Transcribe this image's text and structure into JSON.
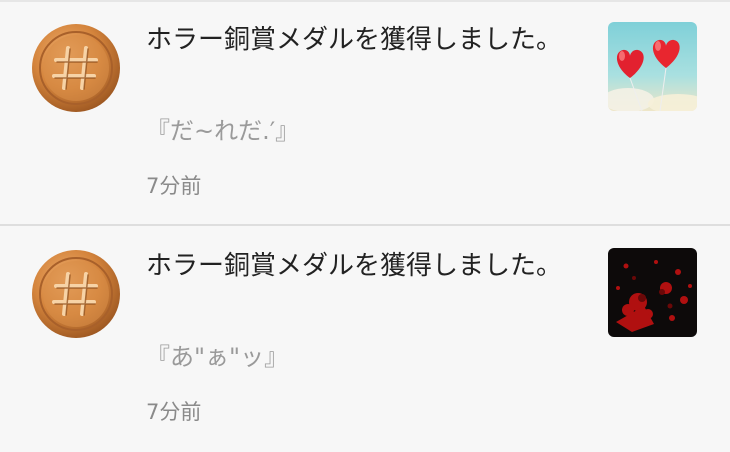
{
  "notifications": [
    {
      "message": "ホラー銅賞メダルを獲得しました。",
      "story_title": "『だ~れだ.′』",
      "time": "7分前",
      "medal_icon": "bronze-hash-medal-icon",
      "thumbnail": "red-heart-balloons-thumbnail"
    },
    {
      "message": "ホラー銅賞メダルを獲得しました。",
      "story_title": "『あ\"ぁ\"ッ』",
      "time": "7分前",
      "medal_icon": "bronze-hash-medal-icon",
      "thumbnail": "blood-splatter-thumbnail"
    }
  ],
  "colors": {
    "background": "#f7f7f7",
    "divider": "#dedede",
    "medal": "#c47a3a",
    "text_primary": "#222222",
    "text_secondary": "#9a9a9a"
  }
}
